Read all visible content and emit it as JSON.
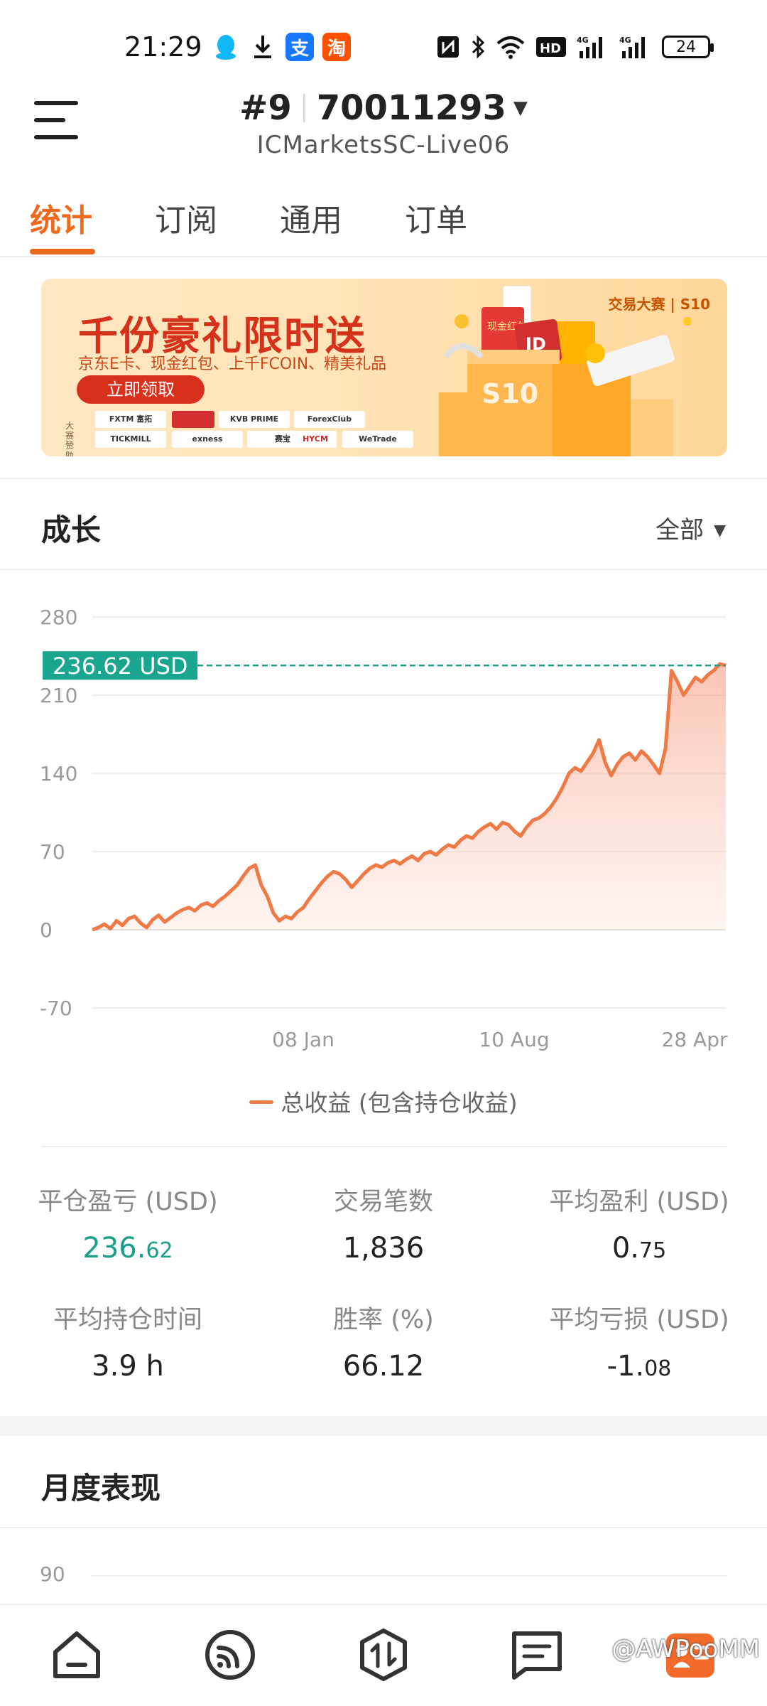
{
  "status_bar": {
    "time": "21:29",
    "battery": "24",
    "apps": [
      "qq-icon",
      "download-icon",
      "alipay-icon",
      "taobao-icon"
    ],
    "app_glyphs": {
      "alipay": "支",
      "taobao": "淘"
    },
    "indicators": [
      "nfc-icon",
      "bluetooth-icon",
      "wifi-icon",
      "hd-icon",
      "4g-signal-icon",
      "4g-signal-icon"
    ]
  },
  "header": {
    "account_prefix": "#9",
    "account_number": "70011293",
    "server": "ICMarketsSC-Live06"
  },
  "tabs": [
    {
      "label": "统计",
      "active": true
    },
    {
      "label": "订阅",
      "active": false
    },
    {
      "label": "通用",
      "active": false
    },
    {
      "label": "订单",
      "active": false
    }
  ],
  "banner": {
    "title": "千份豪礼限时送",
    "subtitle": "京东E卡、现金红包、上千FCOIN、精美礼品",
    "button": "立即领取",
    "brand": "交易大赛 | S10",
    "sponsor_label": "大赛赞助",
    "sponsors": [
      "FXTM 富拓",
      "",
      "KVB PRIME",
      "ForexClub",
      "TICKMILL",
      "exness",
      "赛宝",
      "HYCM",
      "WeTrade"
    ],
    "box_text": {
      "red_box": "现金红包",
      "jd_box": "JD",
      "s10": "S10"
    }
  },
  "growth": {
    "title": "成长",
    "range": "全部",
    "current_label": "236.62 USD",
    "legend": "总收益 (包含持仓收益)"
  },
  "chart_data": {
    "type": "area",
    "title": "",
    "y_ticks": [
      "280",
      "210",
      "140",
      "70",
      "0",
      "-70"
    ],
    "x_ticks": [
      "08 Jan",
      "10 Aug",
      "28 Apr"
    ],
    "ylim": [
      -70,
      280
    ],
    "current_value": 236.62,
    "series": [
      {
        "name": "总收益 (包含持仓收益)",
        "color": "#f07a45",
        "values": [
          0,
          2,
          5,
          1,
          8,
          4,
          10,
          12,
          6,
          2,
          9,
          13,
          7,
          11,
          15,
          18,
          20,
          17,
          22,
          24,
          21,
          26,
          30,
          35,
          40,
          48,
          55,
          58,
          40,
          30,
          15,
          8,
          12,
          10,
          16,
          20,
          28,
          35,
          42,
          48,
          52,
          50,
          45,
          38,
          44,
          50,
          55,
          58,
          56,
          60,
          62,
          59,
          63,
          66,
          62,
          68,
          70,
          67,
          72,
          76,
          74,
          80,
          84,
          82,
          88,
          92,
          95,
          90,
          96,
          94,
          88,
          84,
          92,
          98,
          100,
          104,
          110,
          118,
          128,
          140,
          145,
          142,
          150,
          158,
          170,
          150,
          138,
          148,
          155,
          158,
          152,
          160,
          155,
          148,
          140,
          162,
          232,
          222,
          210,
          218,
          226,
          222,
          228,
          232,
          238,
          236.62
        ]
      }
    ]
  },
  "stats": [
    {
      "label": "平仓盈亏 (USD)",
      "int": "236.",
      "dec": "62",
      "green": true
    },
    {
      "label": "交易笔数",
      "int": "1,836",
      "dec": "",
      "green": false
    },
    {
      "label": "平均盈利 (USD)",
      "int": "0.",
      "dec": "75",
      "green": false
    },
    {
      "label": "平均持仓时间",
      "int": "3.9 h",
      "dec": "",
      "green": false
    },
    {
      "label": "胜率 (%)",
      "int": "66.12",
      "dec": "",
      "green": false
    },
    {
      "label": "平均亏损 (USD)",
      "int": "-1.",
      "dec": "08",
      "green": false
    }
  ],
  "monthly": {
    "title": "月度表现",
    "first_tick": "90"
  },
  "bottom_nav": [
    "home-icon",
    "signal-icon",
    "trade-icon",
    "news-icon",
    "profile-icon"
  ],
  "watermark": "@AWPooMM"
}
